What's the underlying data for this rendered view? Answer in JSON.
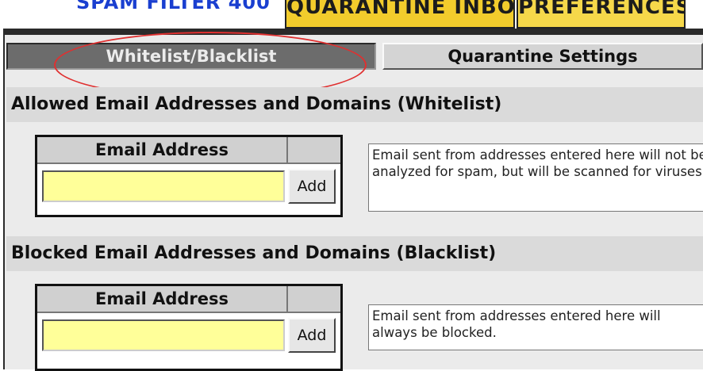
{
  "header": {
    "brand": "SPAM FILTER 400",
    "tabs": [
      {
        "label": "QUARANTINE INBOX"
      },
      {
        "label": "PREFERENCES"
      }
    ]
  },
  "subtabs": [
    {
      "label": "Whitelist/Blacklist",
      "active": true
    },
    {
      "label": "Quarantine Settings",
      "active": false
    }
  ],
  "whitelist": {
    "heading": "Allowed Email Addresses and Domains (Whitelist)",
    "column_header": "Email Address",
    "input_value": "",
    "add_label": "Add",
    "description": "Email sent from addresses entered here will not be analyzed for spam, but will be scanned for viruses."
  },
  "blacklist": {
    "heading": "Blocked Email Addresses and Domains (Blacklist)",
    "column_header": "Email Address",
    "input_value": "",
    "add_label": "Add",
    "description": "Email sent from addresses entered here will always be blocked."
  },
  "annotation_color": "#e03030"
}
